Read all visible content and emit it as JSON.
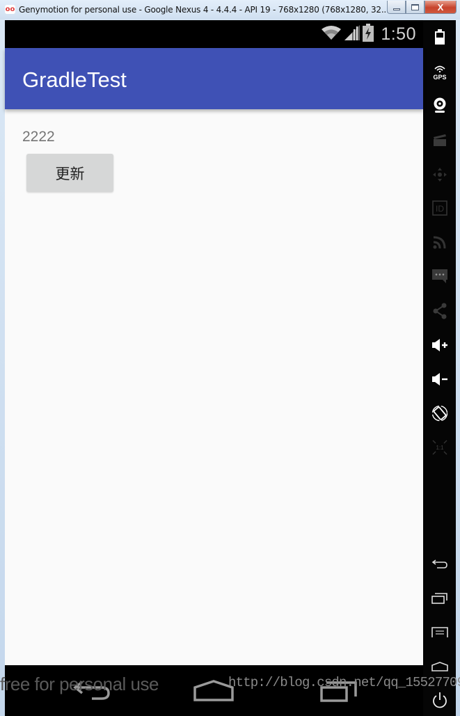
{
  "window": {
    "title": "Genymotion for personal use - Google Nexus 4 - 4.4.4 - API 19 - 768x1280 (768x1280, 32...",
    "app_icon_glyph": "oo",
    "controls": {
      "minimize": "minimize",
      "maximize": "maximize",
      "close_glyph": "X"
    }
  },
  "statusbar": {
    "icons": [
      "wifi-icon",
      "signal-icon",
      "battery-charging-icon"
    ],
    "time": "1:50"
  },
  "appbar": {
    "title": "GradleTest",
    "color": "#3f51b5"
  },
  "content": {
    "text": "2222",
    "button_label": "更新"
  },
  "navbar": {
    "buttons": [
      "back",
      "home",
      "recent-apps"
    ]
  },
  "watermarks": {
    "license": "free for personal use",
    "url": "http://blog.csdn.net/qq_15527709"
  },
  "sidebar": {
    "top_items": [
      {
        "name": "battery",
        "label": ""
      },
      {
        "name": "gps",
        "label": "GPS"
      },
      {
        "name": "webcam",
        "label": ""
      },
      {
        "name": "screencast",
        "label": ""
      },
      {
        "name": "remote-control",
        "label": ""
      },
      {
        "name": "device-id",
        "label": "ID"
      },
      {
        "name": "network",
        "label": ""
      },
      {
        "name": "sms",
        "label": "..."
      },
      {
        "name": "share",
        "label": ""
      },
      {
        "name": "volume-up",
        "label": "+"
      },
      {
        "name": "volume-down",
        "label": "−"
      },
      {
        "name": "rotate",
        "label": ""
      },
      {
        "name": "pixel-perfect",
        "label": "1:1"
      }
    ],
    "bottom_items": [
      {
        "name": "back"
      },
      {
        "name": "recent-apps"
      },
      {
        "name": "menu"
      },
      {
        "name": "home"
      },
      {
        "name": "power"
      }
    ]
  }
}
